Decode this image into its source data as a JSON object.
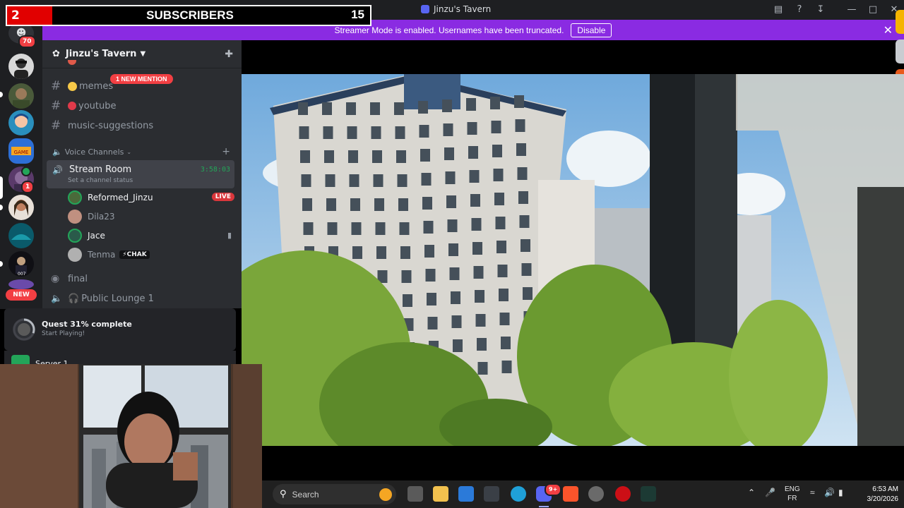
{
  "window": {
    "title": "Jinzu's Tavern"
  },
  "overlay": {
    "subscriber_count": "2",
    "label": "SUBSCRIBERS",
    "goal": "15"
  },
  "banner": {
    "message": "Streamer Mode is enabled. Usernames have been truncated.",
    "action": "Disable"
  },
  "rail": {
    "dm_badge": "70",
    "unread_badge": "1",
    "new_label": "NEW"
  },
  "server": {
    "name": "Jinzu's Tavern"
  },
  "channels": {
    "mention_pill": "1 NEW MENTION",
    "text": [
      {
        "label": "memes"
      },
      {
        "label": "youtube"
      },
      {
        "label": "music-suggestions"
      }
    ],
    "voice_category": "Voice Channels",
    "active_voice": {
      "name": "Stream Room",
      "status": "Set a channel status",
      "timer": "3:58:03"
    },
    "members": [
      {
        "name": "Reformed_Jinzu",
        "badge": "LIVE"
      },
      {
        "name": "Dila23"
      },
      {
        "name": "Jace"
      },
      {
        "name": "Tenma",
        "tag": "CHAK"
      }
    ],
    "other": [
      {
        "label": "final"
      },
      {
        "label": "Public Lounge 1"
      }
    ]
  },
  "quest": {
    "title": "Quest 31% complete",
    "subtitle": "Start Playing!",
    "progress": 31
  },
  "lower_panel": {
    "label": "Server 1"
  },
  "taskbar": {
    "search_placeholder": "Search",
    "discord_badge": "9+",
    "lang_top": "ENG",
    "lang_bottom": "FR",
    "time": "6:53 AM",
    "date": "3/20/2026"
  },
  "colors": {
    "accent_purple": "#8a2be2",
    "discord_blurple": "#5865f2",
    "live_red": "#da373c",
    "online_green": "#23a559",
    "subscriber_red": "#e10000"
  }
}
